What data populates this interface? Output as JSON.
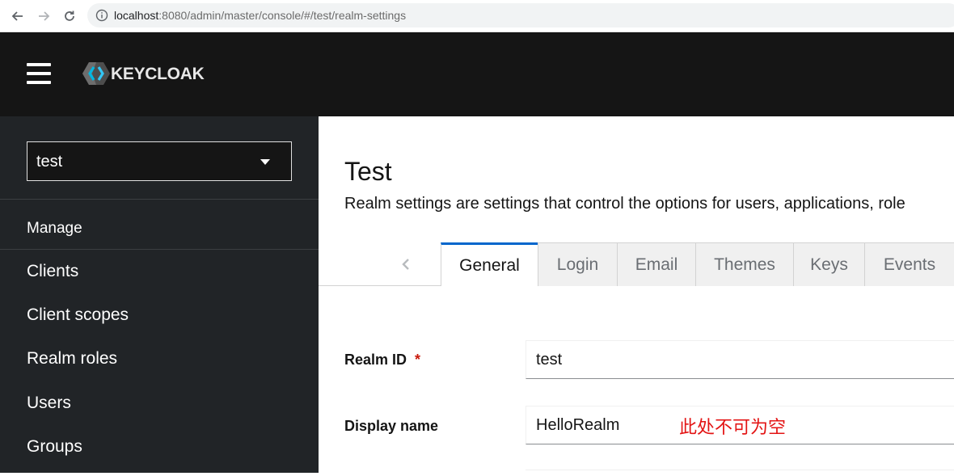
{
  "browser": {
    "url_host": "localhost",
    "url_rest": ":8080/admin/master/console/#/test/realm-settings"
  },
  "masthead": {
    "logo_text": "KEYCLOAK"
  },
  "sidebar": {
    "realm_selector": "test",
    "section": "Manage",
    "items": [
      {
        "label": "Clients"
      },
      {
        "label": "Client scopes"
      },
      {
        "label": "Realm roles"
      },
      {
        "label": "Users"
      },
      {
        "label": "Groups"
      }
    ]
  },
  "main": {
    "title": "Test",
    "description": "Realm settings are settings that control the options for users, applications, role",
    "tabs": [
      {
        "label": "General",
        "active": true
      },
      {
        "label": "Login"
      },
      {
        "label": "Email"
      },
      {
        "label": "Themes"
      },
      {
        "label": "Keys"
      },
      {
        "label": "Events"
      }
    ],
    "form": {
      "realm_id_label": "Realm ID",
      "required_marker": "*",
      "realm_id_value": "test",
      "display_name_label": "Display name",
      "display_name_value": "HelloRealm",
      "annotation": "此处不可为空"
    }
  },
  "colors": {
    "masthead_bg": "#151515",
    "sidebar_bg": "#212427",
    "tab_active_border": "#0066cc",
    "required": "#c9190b",
    "annotation": "#e31414"
  }
}
